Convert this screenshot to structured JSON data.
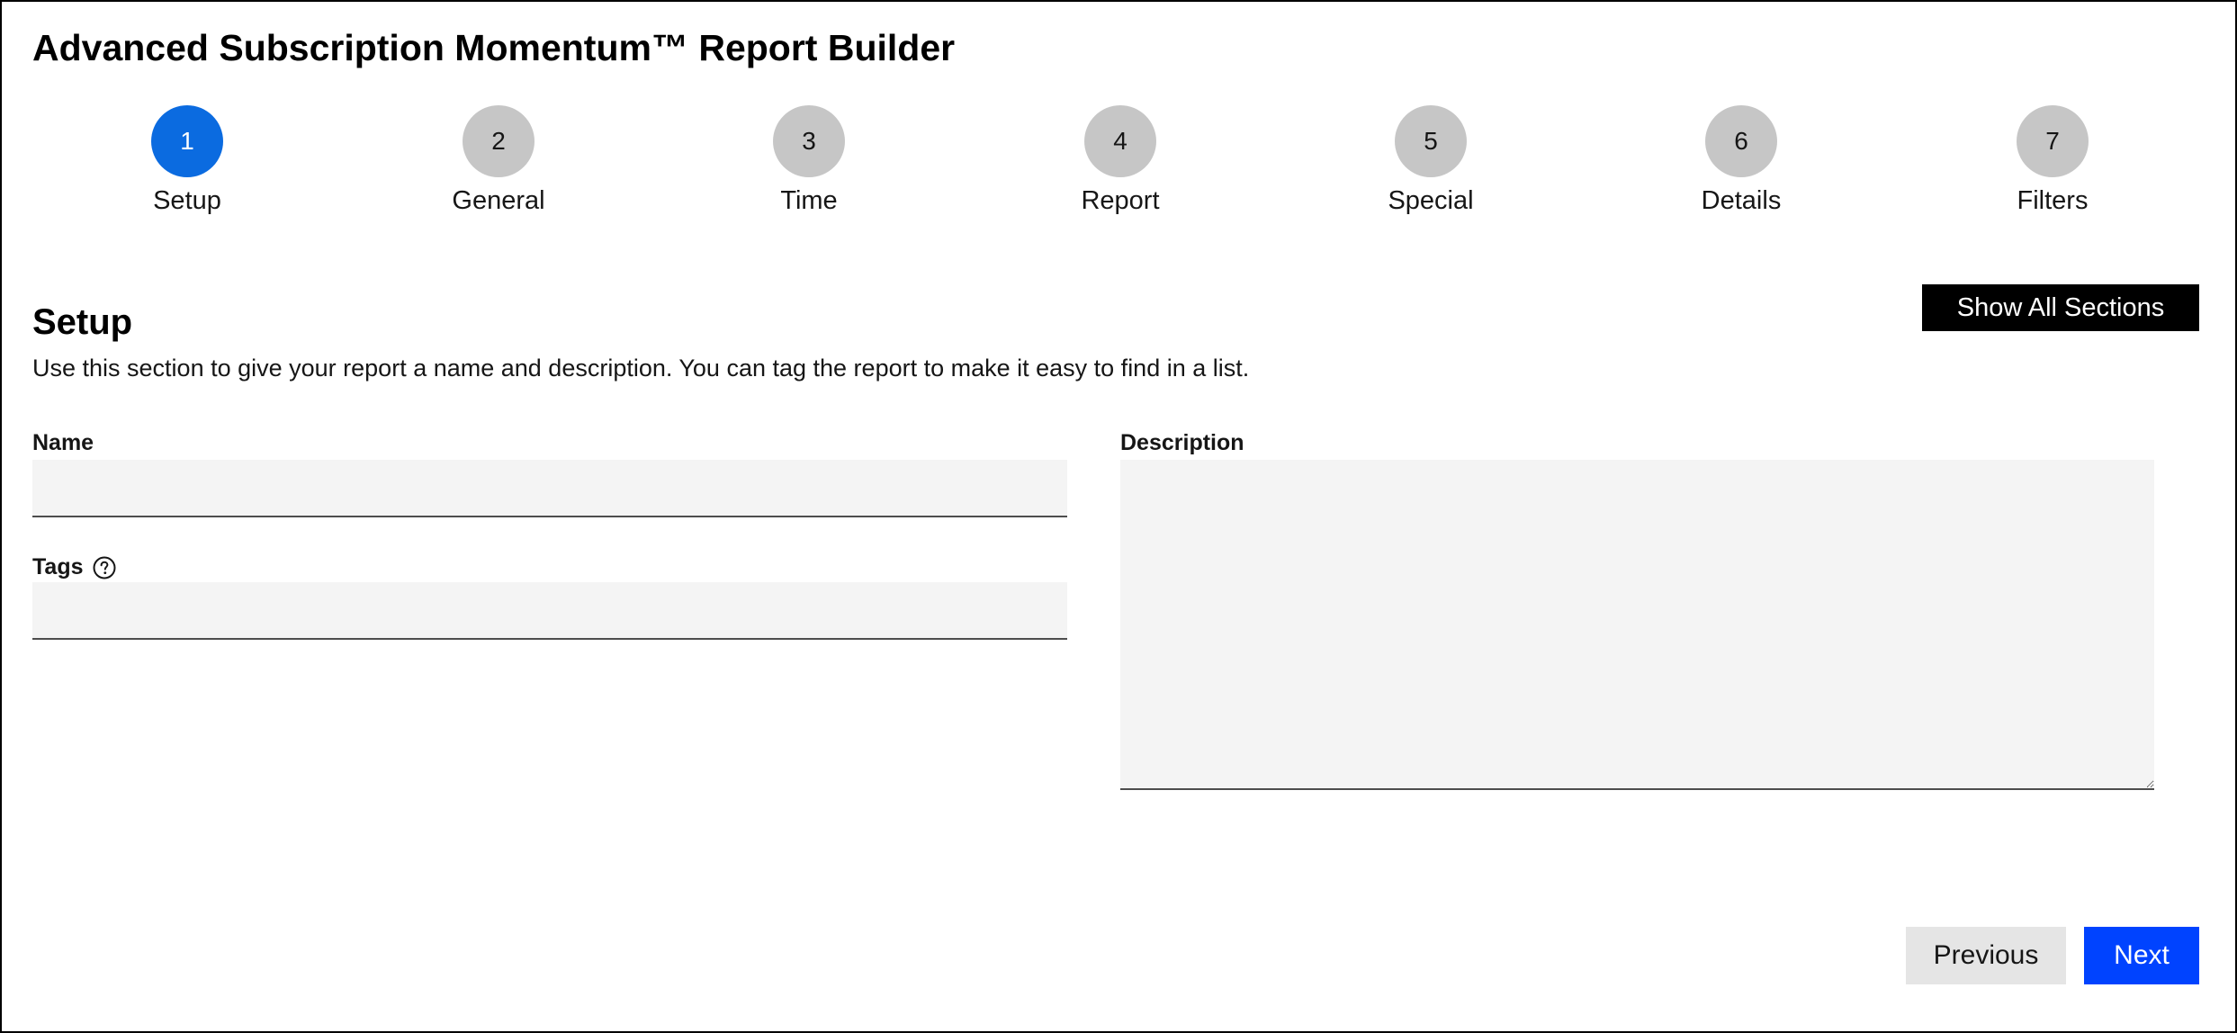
{
  "app": {
    "title": "Advanced Subscription Momentum™ Report Builder"
  },
  "stepper": {
    "active_step": 1,
    "steps": [
      {
        "number": "1",
        "label": "Setup"
      },
      {
        "number": "2",
        "label": "General"
      },
      {
        "number": "3",
        "label": "Time"
      },
      {
        "number": "4",
        "label": "Report"
      },
      {
        "number": "5",
        "label": "Special"
      },
      {
        "number": "6",
        "label": "Details"
      },
      {
        "number": "7",
        "label": "Filters"
      }
    ]
  },
  "section": {
    "title": "Setup",
    "description": "Use this section to give your report a name and description. You can tag the report to make it easy to find in a list.",
    "show_all_label": "Show All Sections"
  },
  "form": {
    "name": {
      "label": "Name",
      "value": ""
    },
    "tags": {
      "label": "Tags",
      "value": "",
      "help_icon": "question-circle-icon"
    },
    "description": {
      "label": "Description",
      "value": ""
    }
  },
  "footer": {
    "previous_label": "Previous",
    "next_label": "Next"
  },
  "colors": {
    "active_step": "#0b6be0",
    "inactive_step": "#c6c6c6",
    "primary_button": "#0043ff",
    "secondary_button": "#e5e5e5",
    "dark_button": "#000000",
    "field_background": "#f4f4f4"
  }
}
